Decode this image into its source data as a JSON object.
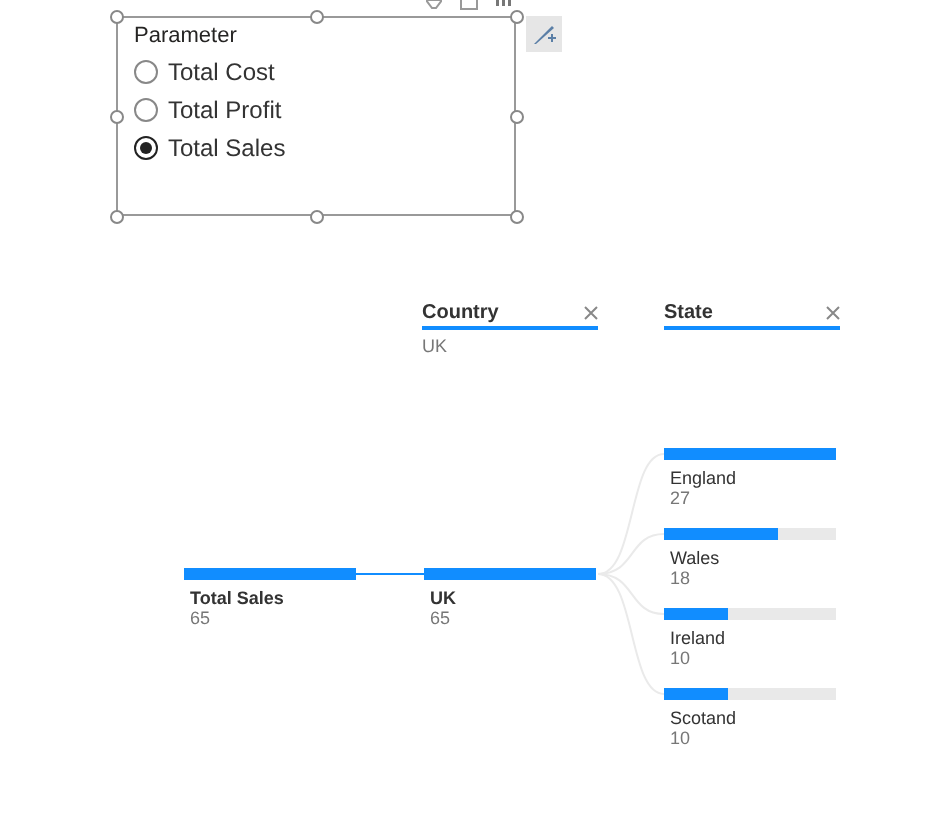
{
  "slicer": {
    "title": "Parameter",
    "options": [
      {
        "label": "Total Cost",
        "selected": false
      },
      {
        "label": "Total Profit",
        "selected": false
      },
      {
        "label": "Total Sales",
        "selected": true
      }
    ]
  },
  "tree": {
    "levels": [
      {
        "header": "Country",
        "filter": "UK"
      },
      {
        "header": "State"
      }
    ],
    "root": {
      "label": "Total Sales",
      "value": "65",
      "level": 1
    },
    "country": {
      "label": "UK",
      "value": "65",
      "level": 1
    },
    "states": [
      {
        "label": "England",
        "value": "27",
        "level": 1
      },
      {
        "label": "Wales",
        "value": "18",
        "level": 0.667
      },
      {
        "label": "Ireland",
        "value": "10",
        "level": 0.37
      },
      {
        "label": "Scotand",
        "value": "10",
        "level": 0.37
      }
    ]
  }
}
